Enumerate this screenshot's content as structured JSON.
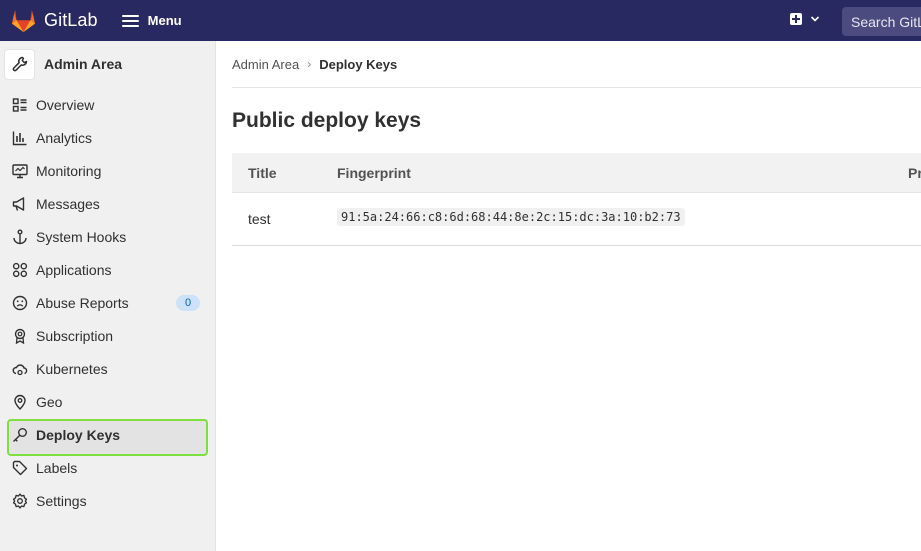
{
  "topbar": {
    "brand": "GitLab",
    "menu_label": "Menu",
    "search_placeholder": "Search GitLab"
  },
  "sidebar": {
    "title": "Admin Area",
    "items": [
      {
        "label": "Overview",
        "icon": "overview-icon"
      },
      {
        "label": "Analytics",
        "icon": "chart-icon"
      },
      {
        "label": "Monitoring",
        "icon": "monitor-icon"
      },
      {
        "label": "Messages",
        "icon": "bullhorn-icon"
      },
      {
        "label": "System Hooks",
        "icon": "anchor-icon"
      },
      {
        "label": "Applications",
        "icon": "apps-icon"
      },
      {
        "label": "Abuse Reports",
        "icon": "sad-face-icon",
        "badge": "0"
      },
      {
        "label": "Subscription",
        "icon": "ribbon-icon"
      },
      {
        "label": "Kubernetes",
        "icon": "cloud-gear-icon"
      },
      {
        "label": "Geo",
        "icon": "location-icon"
      },
      {
        "label": "Deploy Keys",
        "icon": "key-icon",
        "active": true
      },
      {
        "label": "Labels",
        "icon": "tag-icon"
      },
      {
        "label": "Settings",
        "icon": "gear-icon"
      }
    ]
  },
  "breadcrumb": {
    "parent": "Admin Area",
    "current": "Deploy Keys"
  },
  "page": {
    "title": "Public deploy keys"
  },
  "table": {
    "headers": {
      "title": "Title",
      "fingerprint": "Fingerprint",
      "projects": "Pr"
    },
    "rows": [
      {
        "title": "test",
        "fingerprint": "91:5a:24:66:c8:6d:68:44:8e:2c:15:dc:3a:10:b2:73"
      }
    ]
  },
  "colors": {
    "topbar_bg": "#292961",
    "sidebar_bg": "#f0f0f0",
    "active_outline": "#7ee03f",
    "badge_bg": "#cbe2f9"
  }
}
